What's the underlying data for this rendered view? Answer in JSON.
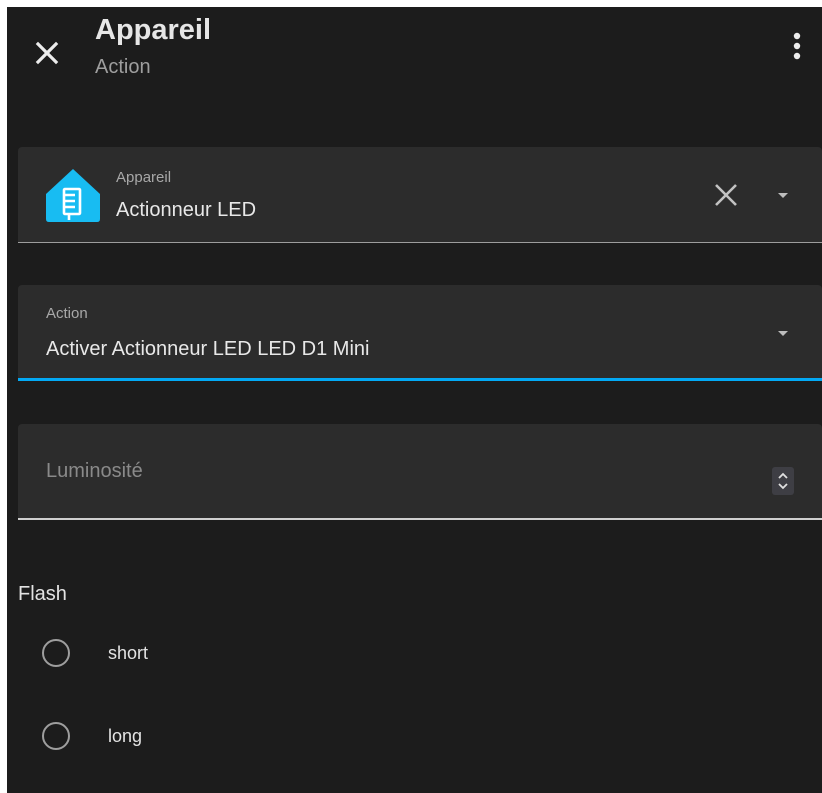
{
  "header": {
    "title": "Appareil",
    "subtitle": "Action",
    "close_icon": "close-icon",
    "menu_icon": "more-vertical-icon"
  },
  "device_field": {
    "label": "Appareil",
    "value": "Actionneur LED",
    "logo_icon": "home-assistant-logo",
    "clear_icon": "close-icon",
    "dropdown_icon": "caret-down-icon"
  },
  "action_field": {
    "label": "Action",
    "value": "Activer Actionneur LED LED D1 Mini",
    "dropdown_icon": "caret-down-icon"
  },
  "brightness_field": {
    "placeholder": "Luminosité",
    "stepper_icon": "stepper-icon"
  },
  "flash": {
    "label": "Flash",
    "options": [
      {
        "label": "short",
        "selected": false
      },
      {
        "label": "long",
        "selected": false
      }
    ]
  },
  "colors": {
    "background": "#1c1c1c",
    "field_background": "#2c2c2c",
    "accent": "#03a9f4",
    "logo": "#18bcf2"
  }
}
